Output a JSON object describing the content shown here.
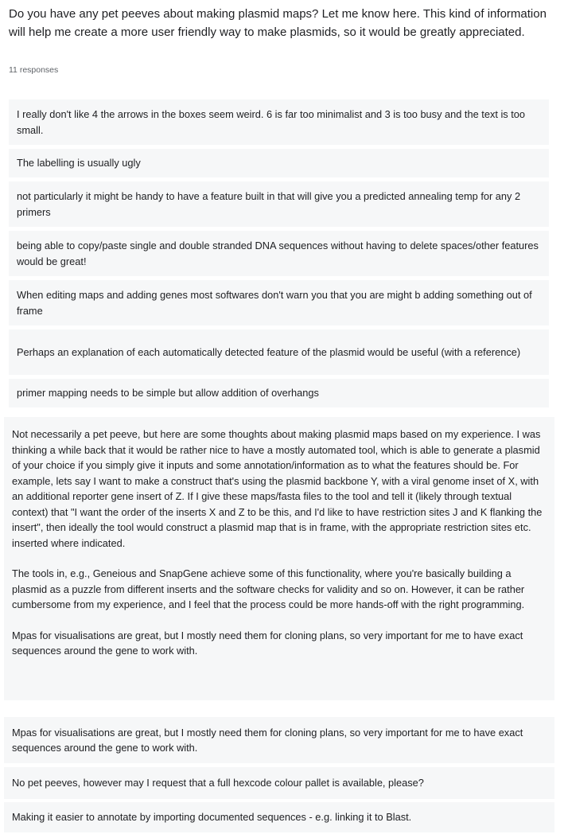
{
  "question": {
    "title": "Do you have any pet peeves about making plasmid maps? Let me know here. This kind of information will help me create a more user friendly way to make plasmids, so it would be greatly appreciated.",
    "response_count": "11 responses"
  },
  "responses": [
    {
      "text": "I really don't like 4 the arrows in the boxes seem weird. 6 is far too minimalist and 3 is too busy and the text is too small."
    },
    {
      "text": "The labelling is usually ugly"
    },
    {
      "text": "not particularly it might be handy to have a feature built in that will give you a predicted annealing temp for any 2 primers"
    },
    {
      "text": "being able to copy/paste single and double stranded DNA sequences without having to delete spaces/other features would be great!"
    },
    {
      "text": "When editing maps and adding genes most softwares don't warn you that you are might b adding something out of frame"
    },
    {
      "text": "Perhaps an explanation of each automatically detected feature of the plasmid would be useful (with a reference)"
    },
    {
      "text": "primer mapping needs to be simple but allow addition of overhangs"
    },
    {
      "paragraph_1": "Not necessarily a pet peeve, but here are some thoughts about making plasmid maps based on my experience. I was thinking a while back that it would be rather nice to have a mostly automated tool, which is able to generate a plasmid of your choice if you simply give it inputs and some annotation/information as to what the features should be. For example, lets say I want to make a construct that's using the plasmid backbone Y, with a viral genome inset of X, with an additional reporter gene insert of Z. If I give these maps/fasta files to the tool and tell it (likely through textual context) that \"I want the order of the inserts X and Z to be this, and I'd like to have restriction sites J and K flanking the insert\", then ideally the tool would construct a plasmid map that is in frame, with the appropriate restriction sites etc. inserted where indicated.",
      "paragraph_2": "The tools in, e.g., Geneious and SnapGene achieve some of this functionality, where you're basically building a plasmid as a puzzle from different inserts and the software checks for validity and so on. However, it can be rather cumbersome from my experience, and I feel that the process could be more hands-off with the right programming."
    },
    {
      "text": "Mpas for visualisations are great, but I mostly need them for cloning plans, so very important for me to have exact sequences around the gene to work with."
    },
    {
      "text": "Mpas for visualisations are great, but I mostly need them for cloning plans, so very important for me to have exact sequences around the gene to work with."
    },
    {
      "text": "No pet peeves, however may I request that a full hexcode colour pallet is available, please?"
    },
    {
      "text": "Making it easier to annotate by importing documented sequences - e.g. linking it to Blast."
    }
  ]
}
